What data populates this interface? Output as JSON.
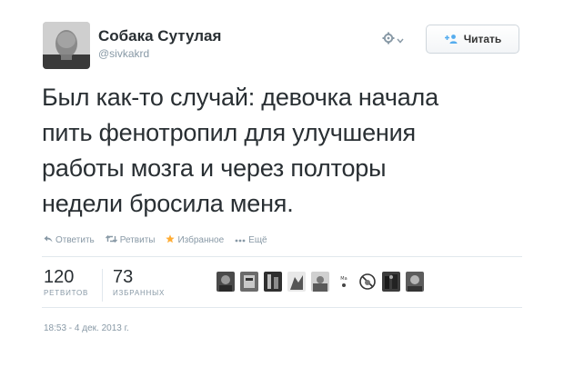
{
  "author": {
    "display_name": "Собака Сутулая",
    "screen_name": "@sivkakrd"
  },
  "header": {
    "follow_label": "Читать",
    "gear_icon": "gear-icon",
    "dropdown_icon": "chevron-down-icon"
  },
  "tweet": {
    "lines": [
      "Был как-то случай: девочка начала",
      "пить фенотропил для улучшения",
      "работы мозга и через полторы",
      "недели бросила меня."
    ]
  },
  "actions": {
    "reply": "Ответить",
    "retweet": "Ретвиты",
    "favorite": "Избранное",
    "more": "Ещё"
  },
  "stats": {
    "retweets_count": "120",
    "retweets_label": "РЕТВИТОВ",
    "favorites_count": "73",
    "favorites_label": "ИЗБРАННЫХ"
  },
  "favoriter_avatars": [
    "avatar-1",
    "avatar-2",
    "avatar-3",
    "avatar-4",
    "avatar-5",
    "avatar-6",
    "avatar-7",
    "avatar-8",
    "avatar-9"
  ],
  "timestamp": "18:53 - 4 дек. 2013 г.",
  "colors": {
    "text": "#292f33",
    "muted": "#8899a6",
    "accent": "#55acee",
    "favorite": "#ffac33",
    "border": "#e1e8ed"
  }
}
